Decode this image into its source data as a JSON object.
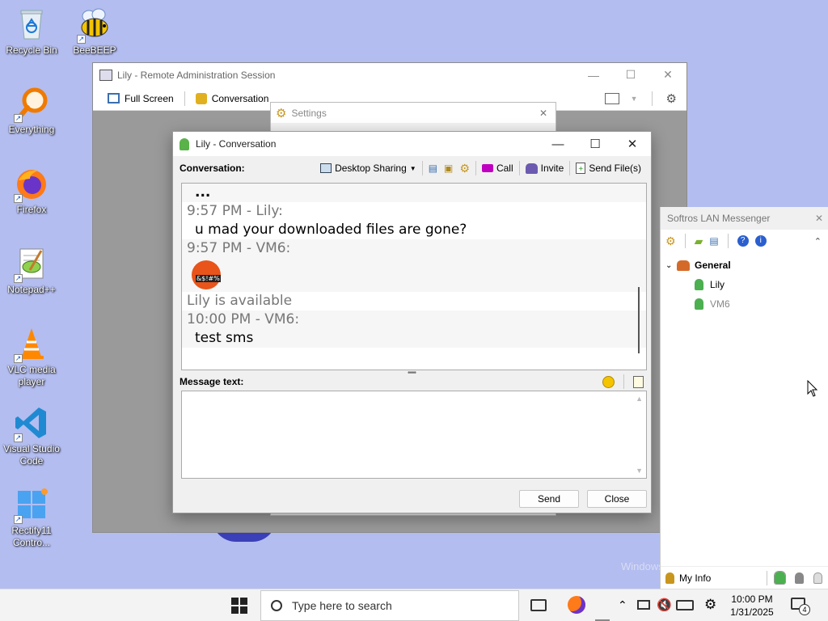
{
  "desktop": {
    "icons": [
      {
        "label": "Recycle Bin"
      },
      {
        "label": "BeeBEEP"
      },
      {
        "label": "Everything"
      },
      {
        "label": "Firefox"
      },
      {
        "label": "Notepad++"
      },
      {
        "label": "VLC media player"
      },
      {
        "label": "Visual Studio Code"
      },
      {
        "label": "Rectify11 Contro..."
      }
    ],
    "watermark": "Windows"
  },
  "remote_window": {
    "title": "Lily - Remote Administration Session",
    "toolbar": {
      "full_screen": "Full Screen",
      "conversation": "Conversation"
    }
  },
  "settings_window": {
    "title": "Settings"
  },
  "conversation_window": {
    "title": "Lily - Conversation",
    "toolbar": {
      "label": "Conversation:",
      "desktop_sharing": "Desktop Sharing",
      "call": "Call",
      "invite": "Invite",
      "send_files": "Send File(s)"
    },
    "messages": [
      {
        "kind": "body",
        "text": "..."
      },
      {
        "kind": "header",
        "text": "9:57 PM - Lily:"
      },
      {
        "kind": "body",
        "text": "u mad your downloaded files are gone?"
      },
      {
        "kind": "header",
        "text": "9:57 PM - VM6:"
      },
      {
        "kind": "emoji",
        "text": "&$!#%"
      },
      {
        "kind": "status",
        "text": "Lily is available"
      },
      {
        "kind": "header",
        "text": "10:00 PM - VM6:"
      },
      {
        "kind": "body",
        "text": "test sms"
      }
    ],
    "message_label": "Message text:",
    "buttons": {
      "send": "Send",
      "close": "Close"
    }
  },
  "softros": {
    "title": "Softros LAN Messenger",
    "group": "General",
    "users": [
      {
        "name": "Lily",
        "status": "online"
      },
      {
        "name": "VM6",
        "status": "self"
      }
    ],
    "my_info": "My Info"
  },
  "taskbar": {
    "search_placeholder": "Type here to search",
    "time": "10:00 PM",
    "date": "1/31/2025",
    "notification_count": "4"
  },
  "colors": {
    "desktop_bg": "#b3bdf0",
    "remote_body": "#9a9a9a",
    "call_icon": "#c000c0",
    "user_green": "#4caf50"
  }
}
